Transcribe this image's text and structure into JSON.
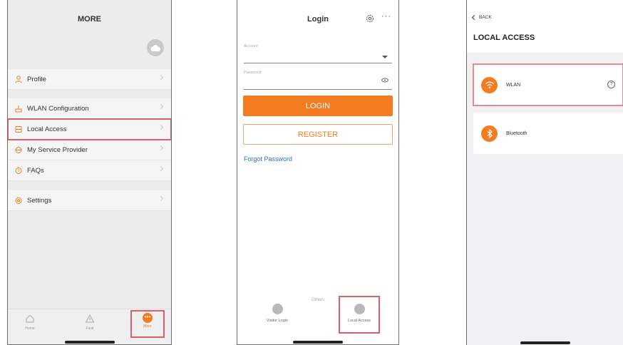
{
  "screen1": {
    "title": "MORE",
    "menu": [
      {
        "label": "Profile",
        "icon": "person-icon"
      },
      {
        "label": "WLAN Configuration",
        "icon": "router-icon"
      },
      {
        "label": "Local Access",
        "icon": "local-access-icon"
      },
      {
        "label": "My Service Provider",
        "icon": "service-icon"
      },
      {
        "label": "FAQs",
        "icon": "question-icon"
      },
      {
        "label": "Settings",
        "icon": "settings-icon"
      }
    ],
    "highlighted_item": "Local Access",
    "tabs": [
      {
        "label": "Home",
        "icon": "home-icon"
      },
      {
        "label": "Fault",
        "icon": "warning-icon"
      },
      {
        "label": "More",
        "icon": "more-icon"
      }
    ]
  },
  "screen2": {
    "title": "Login",
    "account_label": "Account",
    "password_label": "Password",
    "login_button": "LOGIN",
    "register_button": "REGISTER",
    "forgot_link": "Forgot Password",
    "others_label": "Others",
    "options": [
      {
        "label": "Visitor Login",
        "icon": "visitor-icon"
      },
      {
        "label": "Local Access",
        "icon": "local-access-icon"
      }
    ]
  },
  "screen3": {
    "back_label": "BACK",
    "title": "LOCAL ACCESS",
    "items": [
      {
        "label": "WLAN",
        "icon": "wifi-icon"
      },
      {
        "label": "Bluetooth",
        "icon": "bluetooth-icon"
      }
    ]
  },
  "colors": {
    "accent": "#f27c1f",
    "highlight": "#d9606a",
    "link": "#2f6fc8"
  }
}
